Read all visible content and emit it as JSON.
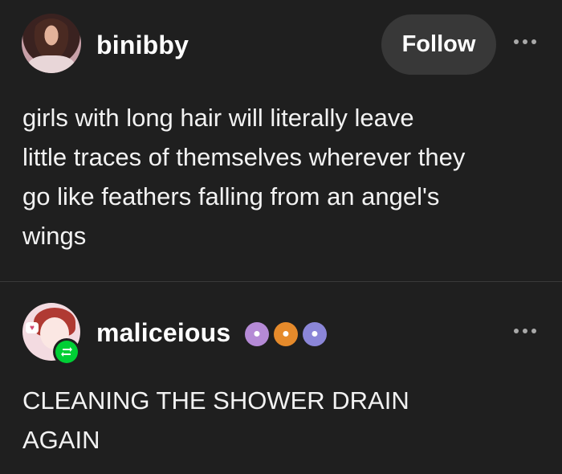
{
  "post1": {
    "username": "binibby",
    "follow_label": "Follow",
    "text_lines": [
      "girls with long hair will literally leave",
      "little traces of themselves wherever they",
      "go like feathers falling from an angel's",
      "wings"
    ],
    "icons": {
      "more": "more-options-icon"
    }
  },
  "post2": {
    "username": "maliceious",
    "badges": [
      "paw-badge-purple",
      "paw-badge-orange",
      "paw-badge-violet"
    ],
    "text_lines": [
      "CLEANING THE SHOWER DRAIN",
      "AGAIN"
    ],
    "icons": {
      "reblog": "reblog-icon",
      "more": "more-options-icon"
    }
  },
  "colors": {
    "background": "#1f1f1f",
    "button": "#383838",
    "reblog_green": "#00cf35"
  }
}
